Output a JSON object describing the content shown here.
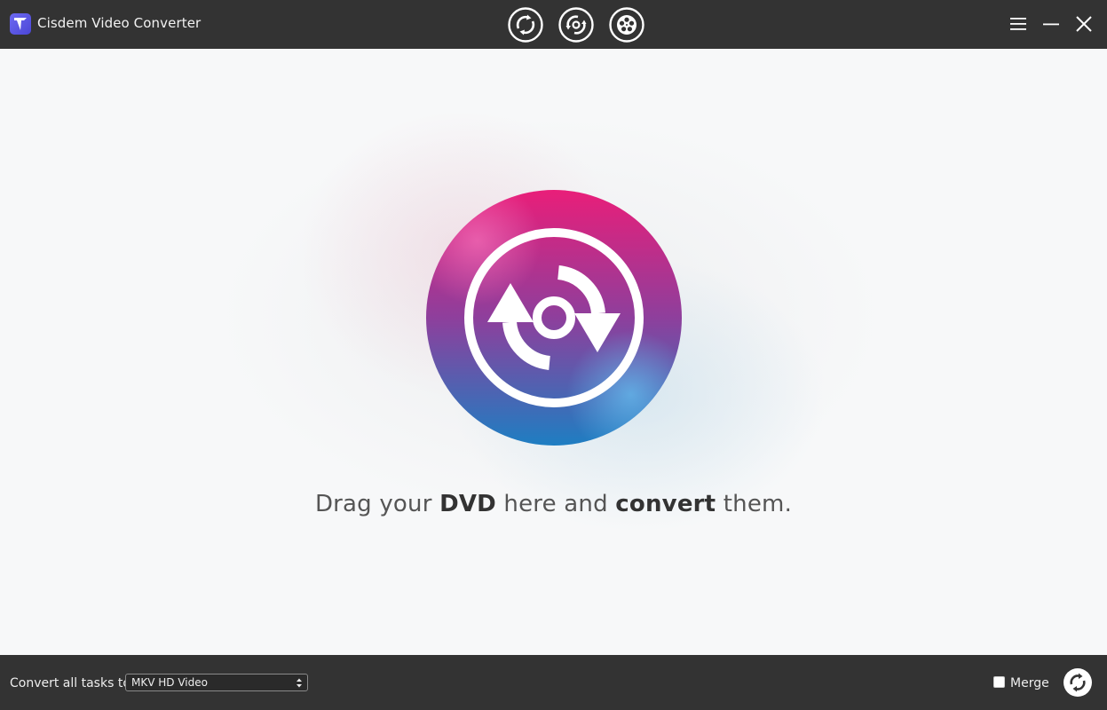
{
  "window": {
    "title": "Cisdem Video Converter",
    "logo_icon": "cisdem-logo-icon"
  },
  "toolbar": {
    "modes": [
      {
        "id": "video-convert",
        "icon": "convert-arrows-icon",
        "active": false
      },
      {
        "id": "dvd-convert",
        "icon": "dvd-convert-icon",
        "active": true
      },
      {
        "id": "video-download",
        "icon": "film-reel-icon",
        "active": false
      }
    ],
    "window_controls": [
      "menu-icon",
      "minimize-icon",
      "close-icon"
    ]
  },
  "drop_zone": {
    "hero_icon": "dvd-convert-icon",
    "message": {
      "part1": "Drag your ",
      "bold1": "DVD",
      "part2": " here and ",
      "bold2": "convert",
      "part3": " them."
    }
  },
  "bottom_bar": {
    "convert_label": "Convert all tasks to",
    "format_selected": "MKV HD Video",
    "merge_label": "Merge",
    "merge_checked": false,
    "convert_icon": "convert-start-icon"
  },
  "colors": {
    "bar_background": "#333333",
    "hero_gradient_top": "#e91e79",
    "hero_gradient_mid": "#8e3f9c",
    "hero_gradient_bottom": "#1e7ec2"
  }
}
